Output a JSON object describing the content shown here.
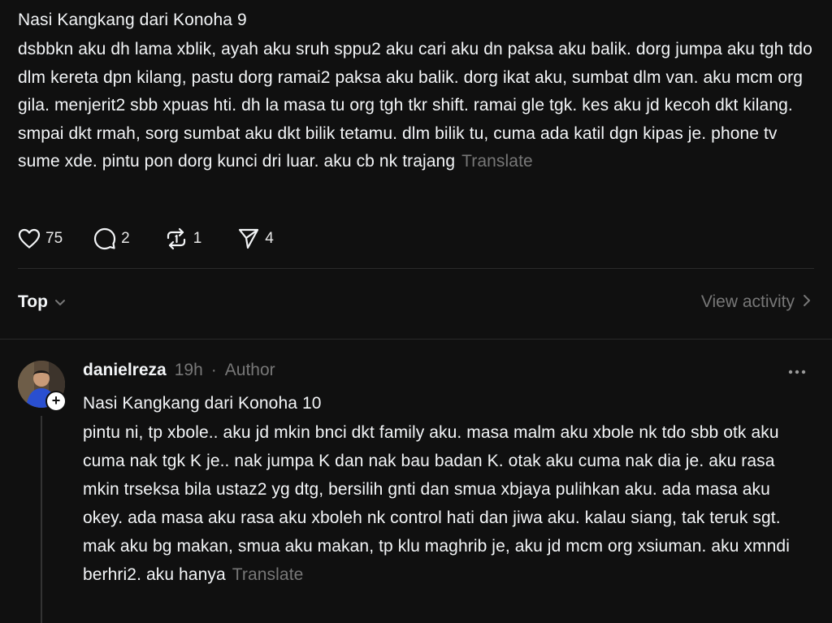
{
  "post": {
    "title": "Nasi Kangkang dari Konoha 9",
    "body": "dsbbkn aku dh lama xblik, ayah aku sruh sppu2 aku cari aku dn paksa aku balik. dorg jumpa aku tgh tdo dlm kereta dpn kilang, pastu dorg ramai2 paksa aku balik. dorg ikat aku, sumbat dlm van. aku mcm org gila. menjerit2 sbb xpuas hti. dh la masa tu org tgh tkr shift. ramai gle tgk. kes aku jd kecoh dkt kilang. smpai dkt rmah, sorg sumbat aku dkt bilik tetamu. dlm bilik tu, cuma ada katil dgn kipas je. phone tv sume xde. pintu pon dorg kunci dri luar. aku cb nk trajang",
    "translate_label": "Translate",
    "actions": {
      "likes": "75",
      "comments": "2",
      "reposts": "1",
      "shares": "4"
    }
  },
  "sort": {
    "label": "Top",
    "icon": "chevron-down-icon"
  },
  "view_activity": {
    "label": "View activity",
    "icon": "chevron-right-icon"
  },
  "reply": {
    "username": "danielreza",
    "time": "19h",
    "separator": "·",
    "badge": "Author",
    "title": "Nasi Kangkang dari Konoha 10",
    "body": "pintu ni, tp xbole.. aku jd mkin bnci dkt family aku. masa malm aku xbole nk tdo sbb otk aku cuma nak tgk K je.. nak jumpa K dan nak bau badan K. otak aku cuma nak dia je. aku rasa mkin trseksa bila ustaz2 yg dtg, bersilih gnti dan smua xbjaya pulihkan aku. ada masa aku okey. ada masa aku rasa aku xboleh nk control hati dan jiwa aku. kalau siang, tak teruk sgt. mak aku bg makan, smua aku makan, tp klu maghrib je, aku jd mcm org xsiuman. aku xmndi berhri2. aku hanya",
    "translate_label": "Translate",
    "plus_label": "+"
  },
  "colors": {
    "background": "#101010",
    "text": "#f3f5f7",
    "muted": "#777777",
    "divider": "#2a2a2a"
  }
}
